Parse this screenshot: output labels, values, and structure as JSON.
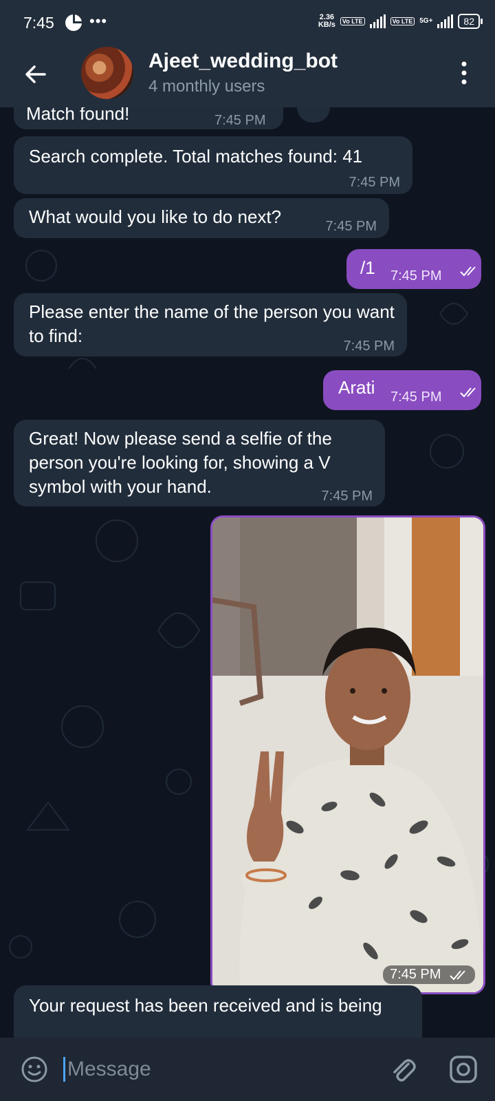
{
  "status_bar": {
    "time": "7:45",
    "more": "•••",
    "speed_value": "2.36",
    "speed_unit": "KB/s",
    "sim1_tag": "Vo LTE",
    "sim2_tag": "Vo LTE",
    "network_type": "5G+",
    "battery": "82"
  },
  "header": {
    "title": "Ajeet_wedding_bot",
    "subtitle": "4 monthly users"
  },
  "messages": [
    {
      "text": "Match found!",
      "time": "7:45 PM"
    },
    {
      "text": "Search complete. Total matches found: 41",
      "time": "7:45 PM"
    },
    {
      "text": "What would you like to do next?",
      "time": "7:45 PM"
    },
    {
      "text": "/1",
      "time": "7:45 PM"
    },
    {
      "text": "Please enter the name of the person you want to find:",
      "time": "7:45 PM"
    },
    {
      "text": "Arati",
      "time": "7:45 PM"
    },
    {
      "text": "Great! Now please send a selfie of the person you're looking for, showing a V symbol with your hand.",
      "time": "7:45 PM"
    },
    {
      "photo": "selfie-photo",
      "time": "7:45 PM"
    },
    {
      "text": "Your request has been received and is being"
    }
  ],
  "input": {
    "placeholder": "Message"
  },
  "colors": {
    "accent_outgoing": "#8a4cc1",
    "incoming_bubble": "#212d3b",
    "background": "#0f1520",
    "header": "#232e3c"
  }
}
